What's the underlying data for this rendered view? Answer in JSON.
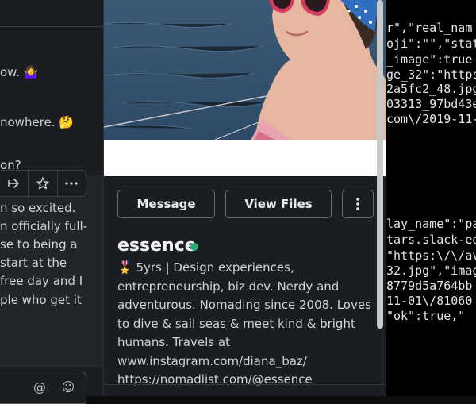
{
  "chat": {
    "lines": [
      "ow. 🤷‍♀️",
      "nowhere. 🤔",
      "on?",
      "n so excited.",
      "n officially full-",
      "se to being a",
      "start at the",
      "free day and I",
      "ple who get it"
    ],
    "toolbar_icons": [
      "share-arrow-icon",
      "star-icon",
      "more-horizontal-icon"
    ],
    "composer_icons": [
      "mention-icon",
      "emoji-icon"
    ],
    "composer_glyphs": {
      "mention": "@",
      "emoji": "☺"
    }
  },
  "profile": {
    "message_button": "Message",
    "view_files_button": "View Files",
    "more_button_icon": "more-vertical-icon",
    "name": "essence",
    "status": "online",
    "bio": "🎖️ 5yrs | Design experiences, entrepreneurship, biz dev. Nerdy and adventurous. Nomading since 2008. Loves to dive & sail seas & meet kind & bright humans. Travels at\nwww.instagram.com/diana_baz/\nhttps://nomadlist.com/@essence",
    "status_color": "#2bac76"
  },
  "code": {
    "lines": [
      "r\",\"real_nam",
      "oji\":\"\",\"stat",
      "_image\":true",
      "ge_32\":\"https",
      "2a5fc2_48.jpg",
      "03313_97bd43e",
      "com\\/2019-11-",
      "",
      "",
      "",
      "",
      "lay_name\":\"pa",
      "tars.slack-ed",
      "\"https:\\/\\/av",
      "32.jpg\",\"imag",
      "8779d5a764bb",
      "11-01\\/81060",
      "\"ok\":true,\""
    ]
  }
}
